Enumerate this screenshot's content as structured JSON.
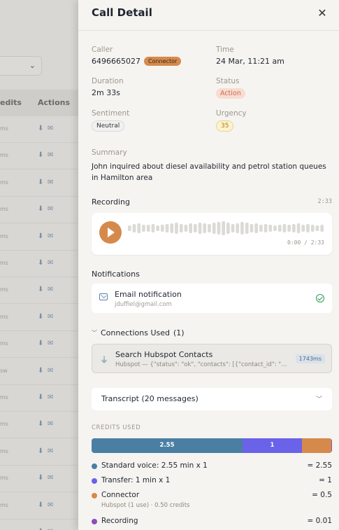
{
  "background": {
    "table_header": {
      "credits": "edits",
      "actions": "Actions"
    },
    "rows": [
      {
        "credits": "ms"
      },
      {
        "credits": "ms"
      },
      {
        "credits": "ms"
      },
      {
        "credits": "ms"
      },
      {
        "credits": "ms"
      },
      {
        "credits": "ms"
      },
      {
        "credits": "ms"
      },
      {
        "credits": "ms"
      },
      {
        "credits": "ms"
      },
      {
        "credits": "sw"
      },
      {
        "credits": "ms"
      },
      {
        "credits": "ms"
      },
      {
        "credits": "ms"
      },
      {
        "credits": "ms"
      },
      {
        "credits": "ms"
      },
      {
        "credits": "ms"
      }
    ]
  },
  "drawer": {
    "title": "Call Detail",
    "caller": {
      "label": "Caller",
      "value": "6496665027",
      "badge": "Connector"
    },
    "time": {
      "label": "Time",
      "value": "24 Mar, 11:21 am"
    },
    "duration": {
      "label": "Duration",
      "value": "2m 33s"
    },
    "status": {
      "label": "Status",
      "value": "Action"
    },
    "sentiment": {
      "label": "Sentiment",
      "value": "Neutral"
    },
    "urgency": {
      "label": "Urgency",
      "value": "35"
    },
    "summary": {
      "label": "Summary",
      "text": "John inquired about diesel availability and petrol station queues in Hamilton area"
    },
    "recording": {
      "label": "Recording",
      "duration": "2:33",
      "time_display": "0:00 / 2:33"
    },
    "notifications": {
      "label": "Notifications",
      "items": [
        {
          "title": "Email notification",
          "recipient": "jduffiel@gmail.com"
        }
      ]
    },
    "connections": {
      "label": "Connections Used",
      "count": "(1)",
      "items": [
        {
          "title": "Search Hubspot Contacts",
          "detail": "Hubspot — {\"status\": \"ok\", \"contacts\": [{\"contact_id\": \"314...",
          "latency": "1743ms"
        }
      ]
    },
    "transcript": {
      "label": "Transcript (20 messages)"
    },
    "credits": {
      "label": "CREDITS USED",
      "colors": {
        "standard": "#4a7fa3",
        "transfer": "#6a62e8",
        "connector": "#d58a4c",
        "recording": "#8a4fbf"
      },
      "bar": [
        {
          "key": "standard",
          "label": "2.55",
          "value": 2.55
        },
        {
          "key": "transfer",
          "label": "1",
          "value": 1
        },
        {
          "key": "connector",
          "label": "",
          "value": 0.5
        },
        {
          "key": "recording",
          "label": "",
          "value": 0.01
        }
      ],
      "rows": [
        {
          "name": "Standard voice: 2.55 min x 1",
          "value": "= 2.55",
          "sub": ""
        },
        {
          "name": "Transfer: 1 min x 1",
          "value": "= 1",
          "sub": ""
        },
        {
          "name": "Connector",
          "value": "= 0.5",
          "sub": "Hubspot (1 use) · 0.50 credits"
        },
        {
          "name": "Recording",
          "value": "= 0.01",
          "sub": ""
        }
      ]
    }
  }
}
